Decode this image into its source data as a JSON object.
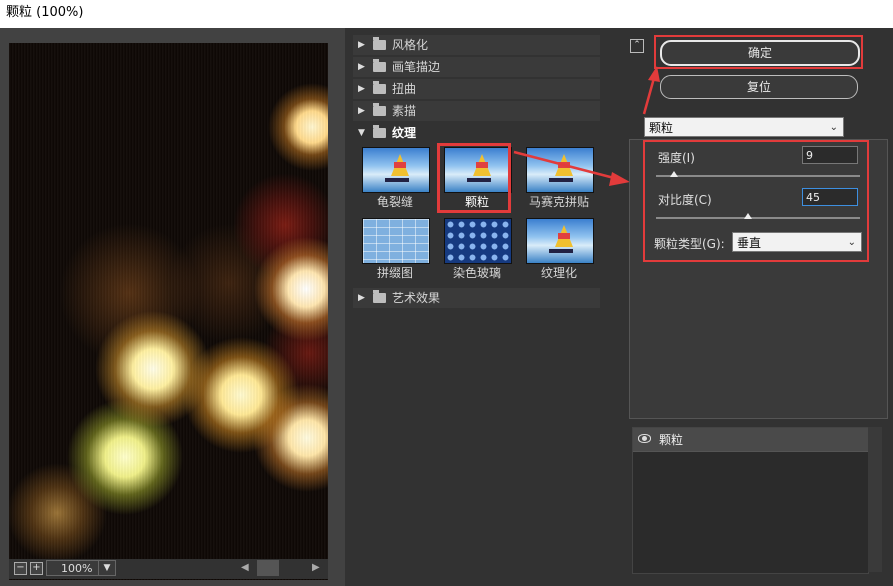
{
  "window": {
    "title": "颗粒 (100%)"
  },
  "preview": {
    "zoom": "100%",
    "zoom_minus": "−",
    "zoom_plus": "+"
  },
  "gallery": {
    "folders_top": [
      "风格化",
      "画笔描边",
      "扭曲",
      "素描"
    ],
    "open_folder": "纹理",
    "filters": [
      {
        "label": "龟裂缝",
        "style": "sky"
      },
      {
        "label": "颗粒",
        "style": "sky"
      },
      {
        "label": "马赛克拼贴",
        "style": "sky"
      },
      {
        "label": "拼缀图",
        "style": "tile"
      },
      {
        "label": "染色玻璃",
        "style": "glass"
      },
      {
        "label": "纹理化",
        "style": "sky"
      }
    ],
    "selected": "颗粒",
    "folders_bottom": [
      "艺术效果"
    ]
  },
  "buttons": {
    "ok": "确定",
    "reset": "复位"
  },
  "filter_select": {
    "value": "颗粒"
  },
  "params": {
    "intensity": {
      "label": "强度(I)",
      "value": "9",
      "fraction": 0.09
    },
    "contrast": {
      "label": "对比度(C)",
      "value": "45",
      "fraction": 0.45
    },
    "grain_type": {
      "label": "颗粒类型(G):",
      "value": "垂直"
    }
  },
  "layers": [
    {
      "label": "颗粒"
    }
  ],
  "colors": {
    "highlight": "#e23b3b",
    "panel": "#323232"
  }
}
